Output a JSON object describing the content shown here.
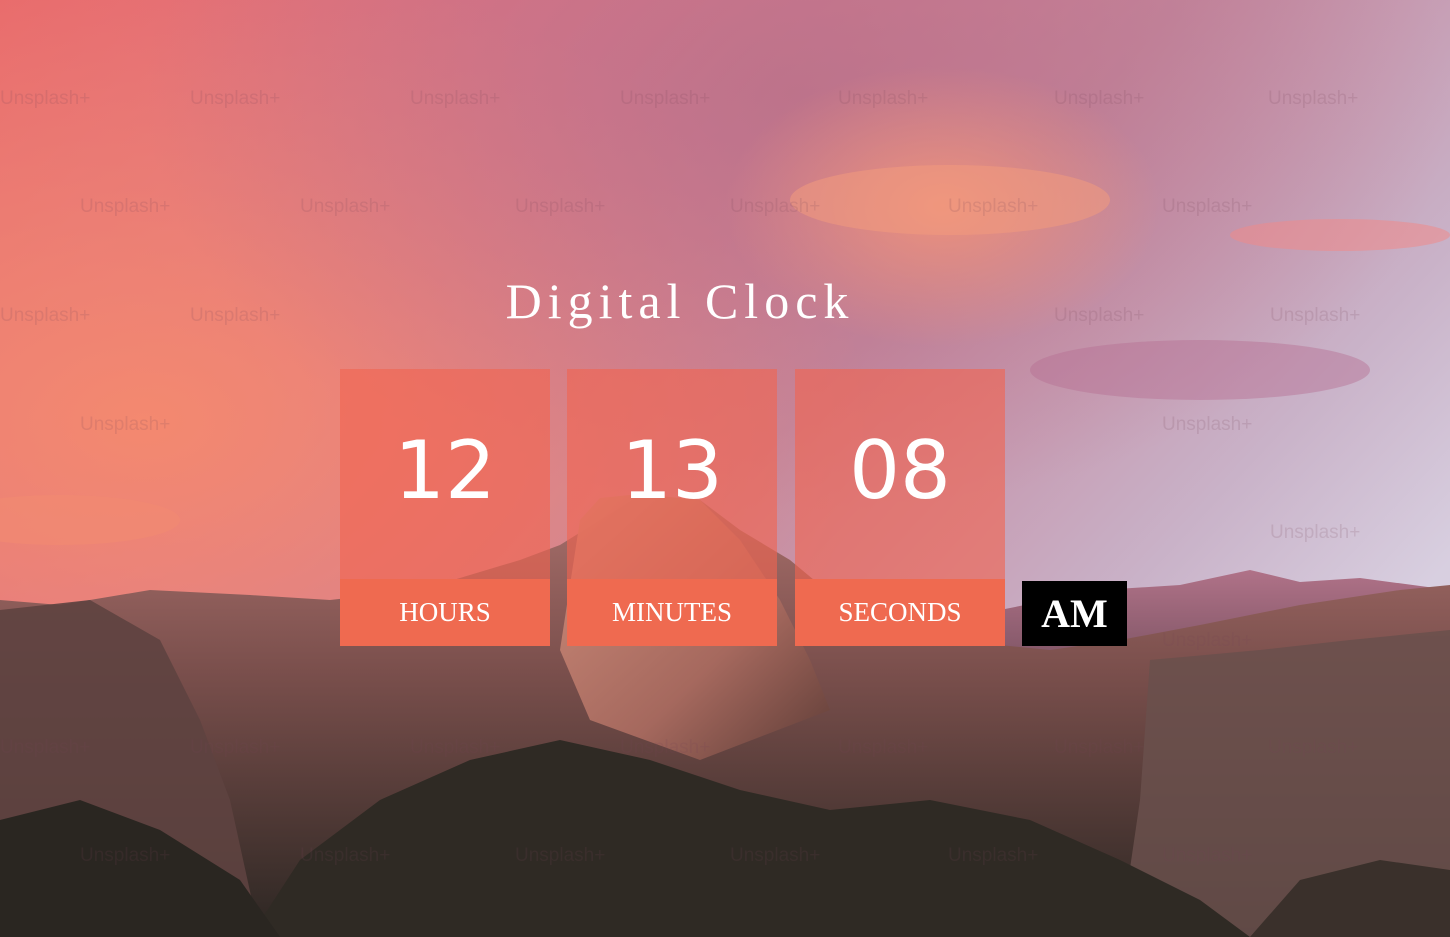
{
  "clock": {
    "title": "Digital Clock",
    "hours": "12",
    "minutes": "13",
    "seconds": "08",
    "hours_label": "HOURS",
    "minutes_label": "MINUTES",
    "seconds_label": "SECONDS",
    "period": "AM"
  },
  "watermark_text": "Unsplash+",
  "colors": {
    "box_fill": "#f06450",
    "label_fill": "#ef6a50",
    "period_fill": "#000000",
    "text": "#ffffff"
  }
}
